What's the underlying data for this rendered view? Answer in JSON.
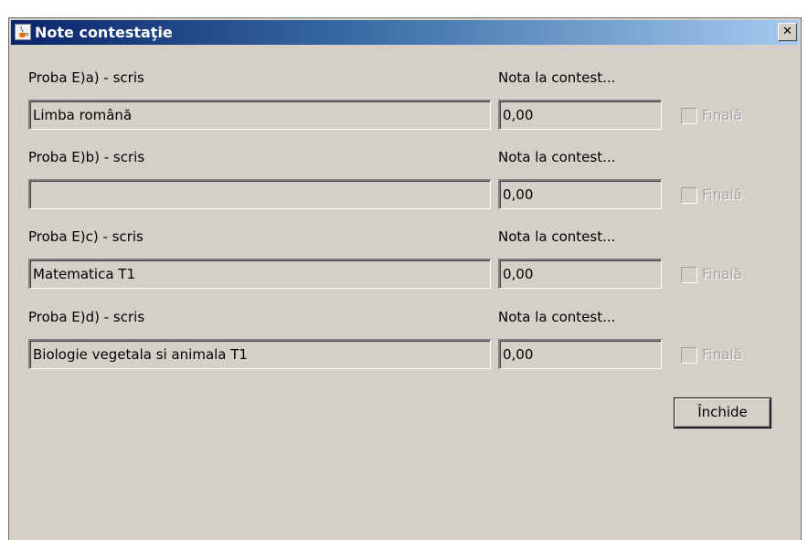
{
  "window": {
    "title": "Note contestaţie",
    "close_glyph": "✕",
    "icon": "java-cup-icon"
  },
  "rows": [
    {
      "exam_label": "Proba E)a) - scris",
      "grade_label": "Nota la contest...",
      "subject": "Limba română",
      "grade": "0,00",
      "final_label": "Finală",
      "final_checked": false
    },
    {
      "exam_label": "Proba E)b) - scris",
      "grade_label": "Nota la contest...",
      "subject": "",
      "grade": "0,00",
      "final_label": "Finală",
      "final_checked": false
    },
    {
      "exam_label": "Proba E)c) - scris",
      "grade_label": "Nota la contest...",
      "subject": "Matematica T1",
      "grade": "0,00",
      "final_label": "Finală",
      "final_checked": false
    },
    {
      "exam_label": "Proba E)d) - scris",
      "grade_label": "Nota la contest...",
      "subject": "Biologie vegetala si animala T1",
      "grade": "0,00",
      "final_label": "Finală",
      "final_checked": false
    }
  ],
  "buttons": {
    "close_label": "Închide"
  }
}
